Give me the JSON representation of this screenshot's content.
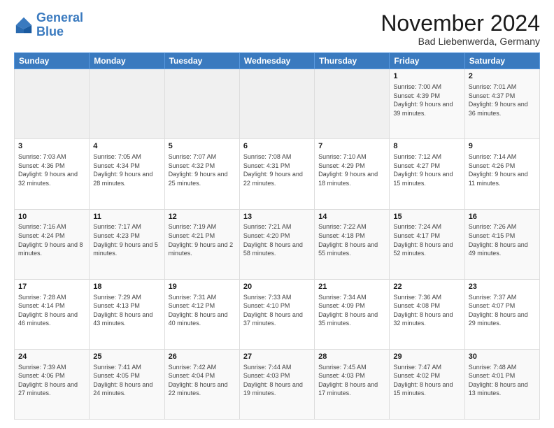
{
  "header": {
    "logo_general": "General",
    "logo_blue": "Blue",
    "month_title": "November 2024",
    "subtitle": "Bad Liebenwerda, Germany"
  },
  "days_of_week": [
    "Sunday",
    "Monday",
    "Tuesday",
    "Wednesday",
    "Thursday",
    "Friday",
    "Saturday"
  ],
  "weeks": [
    [
      {
        "day": "",
        "info": ""
      },
      {
        "day": "",
        "info": ""
      },
      {
        "day": "",
        "info": ""
      },
      {
        "day": "",
        "info": ""
      },
      {
        "day": "",
        "info": ""
      },
      {
        "day": "1",
        "info": "Sunrise: 7:00 AM\nSunset: 4:39 PM\nDaylight: 9 hours and 39 minutes."
      },
      {
        "day": "2",
        "info": "Sunrise: 7:01 AM\nSunset: 4:37 PM\nDaylight: 9 hours and 36 minutes."
      }
    ],
    [
      {
        "day": "3",
        "info": "Sunrise: 7:03 AM\nSunset: 4:36 PM\nDaylight: 9 hours and 32 minutes."
      },
      {
        "day": "4",
        "info": "Sunrise: 7:05 AM\nSunset: 4:34 PM\nDaylight: 9 hours and 28 minutes."
      },
      {
        "day": "5",
        "info": "Sunrise: 7:07 AM\nSunset: 4:32 PM\nDaylight: 9 hours and 25 minutes."
      },
      {
        "day": "6",
        "info": "Sunrise: 7:08 AM\nSunset: 4:31 PM\nDaylight: 9 hours and 22 minutes."
      },
      {
        "day": "7",
        "info": "Sunrise: 7:10 AM\nSunset: 4:29 PM\nDaylight: 9 hours and 18 minutes."
      },
      {
        "day": "8",
        "info": "Sunrise: 7:12 AM\nSunset: 4:27 PM\nDaylight: 9 hours and 15 minutes."
      },
      {
        "day": "9",
        "info": "Sunrise: 7:14 AM\nSunset: 4:26 PM\nDaylight: 9 hours and 11 minutes."
      }
    ],
    [
      {
        "day": "10",
        "info": "Sunrise: 7:16 AM\nSunset: 4:24 PM\nDaylight: 9 hours and 8 minutes."
      },
      {
        "day": "11",
        "info": "Sunrise: 7:17 AM\nSunset: 4:23 PM\nDaylight: 9 hours and 5 minutes."
      },
      {
        "day": "12",
        "info": "Sunrise: 7:19 AM\nSunset: 4:21 PM\nDaylight: 9 hours and 2 minutes."
      },
      {
        "day": "13",
        "info": "Sunrise: 7:21 AM\nSunset: 4:20 PM\nDaylight: 8 hours and 58 minutes."
      },
      {
        "day": "14",
        "info": "Sunrise: 7:22 AM\nSunset: 4:18 PM\nDaylight: 8 hours and 55 minutes."
      },
      {
        "day": "15",
        "info": "Sunrise: 7:24 AM\nSunset: 4:17 PM\nDaylight: 8 hours and 52 minutes."
      },
      {
        "day": "16",
        "info": "Sunrise: 7:26 AM\nSunset: 4:15 PM\nDaylight: 8 hours and 49 minutes."
      }
    ],
    [
      {
        "day": "17",
        "info": "Sunrise: 7:28 AM\nSunset: 4:14 PM\nDaylight: 8 hours and 46 minutes."
      },
      {
        "day": "18",
        "info": "Sunrise: 7:29 AM\nSunset: 4:13 PM\nDaylight: 8 hours and 43 minutes."
      },
      {
        "day": "19",
        "info": "Sunrise: 7:31 AM\nSunset: 4:12 PM\nDaylight: 8 hours and 40 minutes."
      },
      {
        "day": "20",
        "info": "Sunrise: 7:33 AM\nSunset: 4:10 PM\nDaylight: 8 hours and 37 minutes."
      },
      {
        "day": "21",
        "info": "Sunrise: 7:34 AM\nSunset: 4:09 PM\nDaylight: 8 hours and 35 minutes."
      },
      {
        "day": "22",
        "info": "Sunrise: 7:36 AM\nSunset: 4:08 PM\nDaylight: 8 hours and 32 minutes."
      },
      {
        "day": "23",
        "info": "Sunrise: 7:37 AM\nSunset: 4:07 PM\nDaylight: 8 hours and 29 minutes."
      }
    ],
    [
      {
        "day": "24",
        "info": "Sunrise: 7:39 AM\nSunset: 4:06 PM\nDaylight: 8 hours and 27 minutes."
      },
      {
        "day": "25",
        "info": "Sunrise: 7:41 AM\nSunset: 4:05 PM\nDaylight: 8 hours and 24 minutes."
      },
      {
        "day": "26",
        "info": "Sunrise: 7:42 AM\nSunset: 4:04 PM\nDaylight: 8 hours and 22 minutes."
      },
      {
        "day": "27",
        "info": "Sunrise: 7:44 AM\nSunset: 4:03 PM\nDaylight: 8 hours and 19 minutes."
      },
      {
        "day": "28",
        "info": "Sunrise: 7:45 AM\nSunset: 4:03 PM\nDaylight: 8 hours and 17 minutes."
      },
      {
        "day": "29",
        "info": "Sunrise: 7:47 AM\nSunset: 4:02 PM\nDaylight: 8 hours and 15 minutes."
      },
      {
        "day": "30",
        "info": "Sunrise: 7:48 AM\nSunset: 4:01 PM\nDaylight: 8 hours and 13 minutes."
      }
    ]
  ],
  "colors": {
    "header_bg": "#3a7abf",
    "header_text": "#ffffff",
    "odd_row_bg": "#f9f9f9",
    "even_row_bg": "#ffffff",
    "empty_bg": "#f0f0f0"
  }
}
